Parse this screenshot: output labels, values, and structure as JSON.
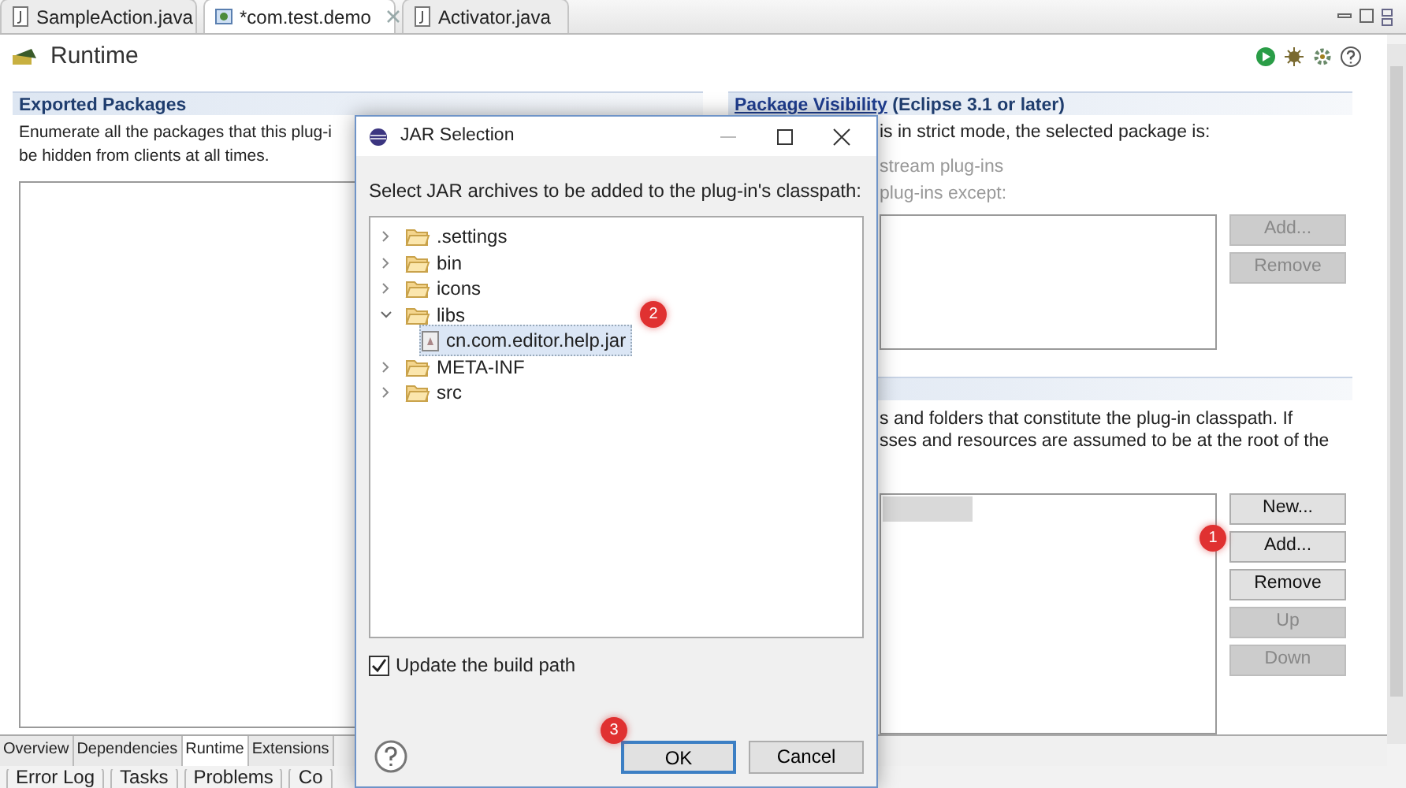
{
  "editor_tabs": [
    {
      "label": "SampleAction.java",
      "selected": false
    },
    {
      "label": "*com.test.demo",
      "selected": true
    },
    {
      "label": "Activator.java",
      "selected": false
    }
  ],
  "form": {
    "title": "Runtime"
  },
  "exported_packages": {
    "title": "Exported Packages",
    "lines": [
      "Enumerate all the packages that this plug-i",
      "be hidden from clients at all times."
    ]
  },
  "package_visibility": {
    "title": "Package Visibility",
    "title_suffix": "(Eclipse 3.1 or later)",
    "lines": [
      {
        "text": "is in strict mode, the selected package is:",
        "disabled": false
      },
      {
        "text": "stream plug-ins",
        "disabled": true
      },
      {
        "text": "plug-ins except:",
        "disabled": true
      }
    ],
    "buttons": [
      {
        "label": "Add...",
        "disabled": true
      },
      {
        "label": "Remove",
        "disabled": true
      }
    ]
  },
  "classpath": {
    "lines": [
      "s and folders that constitute the plug-in classpath.  If",
      "sses and resources are assumed to be at the root of the"
    ],
    "rows": [
      {
        "selected": true
      }
    ],
    "buttons": [
      {
        "label": "New...",
        "disabled": false
      },
      {
        "label": "Add...",
        "disabled": false
      },
      {
        "label": "Remove",
        "disabled": false
      },
      {
        "label": "Up",
        "disabled": true
      },
      {
        "label": "Down",
        "disabled": true
      }
    ]
  },
  "page_tabs": [
    {
      "label": "Overview",
      "selected": false
    },
    {
      "label": "Dependencies",
      "selected": false
    },
    {
      "label": "Runtime",
      "selected": true
    },
    {
      "label": "Extensions",
      "selected": false
    }
  ],
  "view_tabs": [
    {
      "label": "Error Log"
    },
    {
      "label": "Tasks"
    },
    {
      "label": "Problems"
    },
    {
      "label": "Co"
    }
  ],
  "dialog": {
    "title": "JAR Selection",
    "prompt": "Select JAR archives to be added to the plug-in's classpath:",
    "tree": [
      {
        "label": ".settings",
        "expanded": false
      },
      {
        "label": "bin",
        "expanded": false
      },
      {
        "label": "icons",
        "expanded": false
      },
      {
        "label": "libs",
        "expanded": true,
        "children": [
          {
            "label": "cn.com.editor.help.jar",
            "selected": true
          }
        ]
      },
      {
        "label": "META-INF",
        "expanded": false
      },
      {
        "label": "src",
        "expanded": false
      }
    ],
    "checkbox": {
      "label": "Update the build path",
      "checked": true
    },
    "buttons": [
      {
        "label": "OK",
        "default": true
      },
      {
        "label": "Cancel",
        "default": false
      }
    ]
  },
  "callouts": [
    "1",
    "2",
    "3"
  ]
}
